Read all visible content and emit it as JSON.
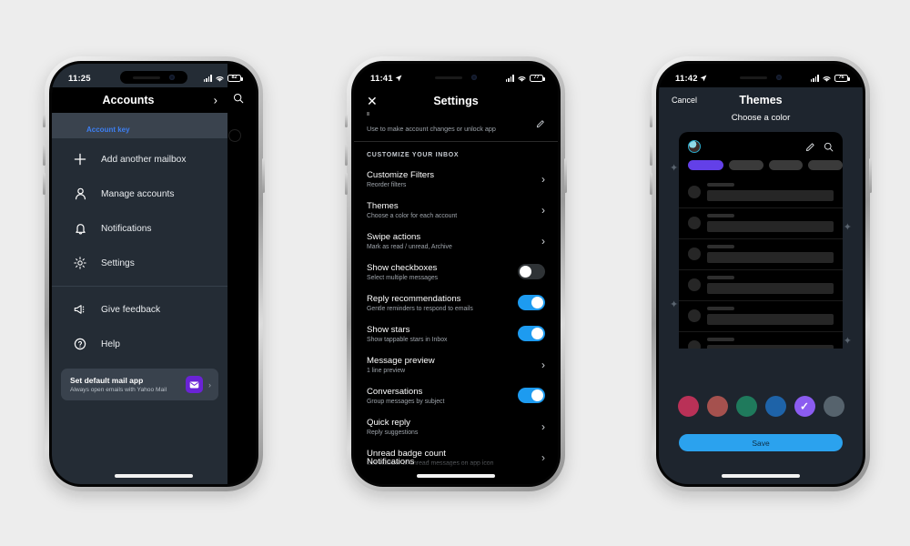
{
  "background_color": "#ededed",
  "phones": [
    {
      "id": "phone-accounts",
      "status_bar": {
        "time": "11:25",
        "battery": "82"
      },
      "header": {
        "title": "Accounts",
        "chevron_icon": "chevron-right-icon",
        "search_icon": "search-icon"
      },
      "account_key_label": "Account key",
      "menu_items": [
        {
          "icon": "plus-icon",
          "label": "Add another mailbox"
        },
        {
          "icon": "person-icon",
          "label": "Manage accounts"
        },
        {
          "icon": "bell-icon",
          "label": "Notifications"
        },
        {
          "icon": "gear-icon",
          "label": "Settings"
        },
        {
          "icon": "megaphone-icon",
          "label": "Give feedback"
        },
        {
          "icon": "question-circle-icon",
          "label": "Help"
        }
      ],
      "default_mail_card": {
        "title": "Set default mail app",
        "subtitle": "Always open emails with Yahoo Mail",
        "app_icon": "yahoo-mail-icon",
        "chevron": "›",
        "icon_color": "#6a23d6"
      }
    },
    {
      "id": "phone-settings",
      "status_bar": {
        "time": "11:41",
        "battery": "77"
      },
      "header": {
        "close_icon": "close-icon",
        "title": "Settings"
      },
      "account_note": "Use to make account changes or unlock app",
      "edit_icon": "pencil-icon",
      "section_header": "CUSTOMIZE YOUR INBOX",
      "rows": [
        {
          "title": "Customize Filters",
          "subtitle": "Reorder filters",
          "control": "chevron"
        },
        {
          "title": "Themes",
          "subtitle": "Choose a color for each account",
          "control": "chevron"
        },
        {
          "title": "Swipe actions",
          "subtitle": "Mark as read / unread, Archive",
          "control": "chevron"
        },
        {
          "title": "Show checkboxes",
          "subtitle": "Select multiple messages",
          "control": "toggle",
          "on": false
        },
        {
          "title": "Reply recommendations",
          "subtitle": "Gentle reminders to respond to emails",
          "control": "toggle",
          "on": true
        },
        {
          "title": "Show stars",
          "subtitle": "Show tappable stars in Inbox",
          "control": "toggle",
          "on": true
        },
        {
          "title": "Message preview",
          "subtitle": "1 line preview",
          "control": "chevron"
        },
        {
          "title": "Conversations",
          "subtitle": "Group messages by subject",
          "control": "toggle",
          "on": true
        },
        {
          "title": "Quick reply",
          "subtitle": "Reply suggestions",
          "control": "chevron"
        },
        {
          "title": "Unread badge count",
          "subtitle": "See number of unread messages on app icon",
          "control": "chevron"
        }
      ],
      "footer_row": {
        "title": "Notifications"
      },
      "toggle_on_color": "#1d9bf0",
      "toggle_off_color": "#2f3336"
    },
    {
      "id": "phone-themes",
      "status_bar": {
        "time": "11:42",
        "battery": "76"
      },
      "header": {
        "cancel_label": "Cancel",
        "title": "Themes"
      },
      "subtitle": "Choose a color",
      "preview": {
        "avatar_icon": "avatar-icon",
        "compose_icon": "pencil-icon",
        "search_icon": "search-icon",
        "selected_chip_color": "#6340e8",
        "chip_widths": [
          48,
          46,
          46,
          46
        ],
        "row_count": 6
      },
      "swatches": [
        {
          "name": "crimson",
          "color": "#b93157",
          "selected": false
        },
        {
          "name": "brick",
          "color": "#a5514e",
          "selected": false
        },
        {
          "name": "green",
          "color": "#1f7a5c",
          "selected": false
        },
        {
          "name": "blue",
          "color": "#1e63a8",
          "selected": false
        },
        {
          "name": "purple",
          "color": "#8b5cf0",
          "selected": true
        },
        {
          "name": "slate",
          "color": "#56636d",
          "selected": false
        }
      ],
      "save_label": "Save",
      "save_color": "#2ba2ee",
      "sparkle_icon": "sparkle-icon"
    }
  ]
}
